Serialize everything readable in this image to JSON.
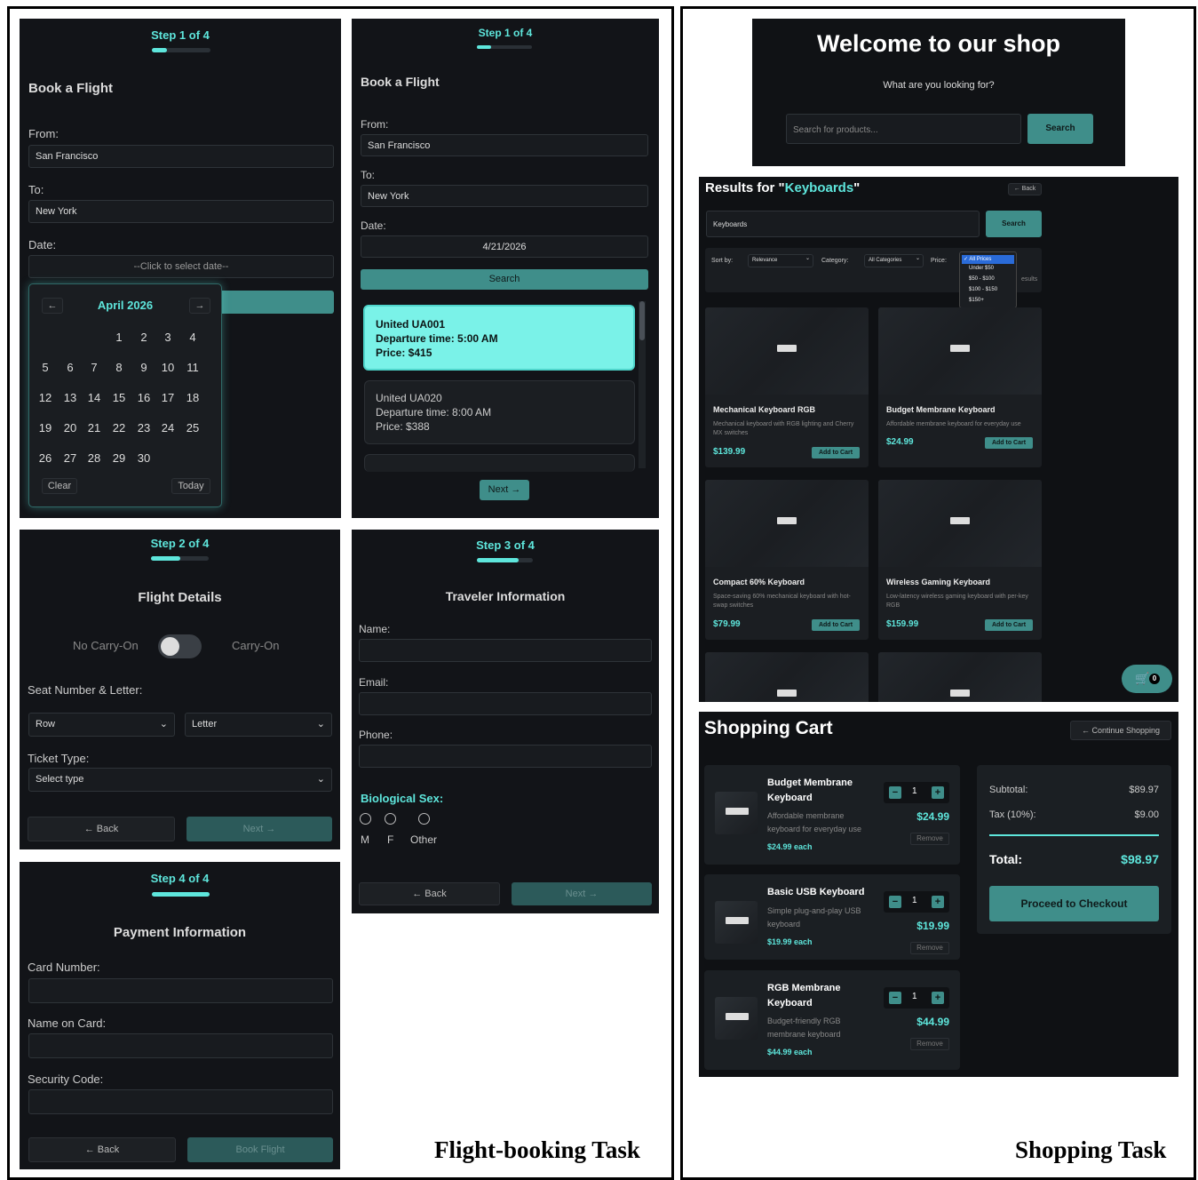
{
  "steps": {
    "s1": "Step 1 of 4",
    "s2": "Step 2 of 4",
    "s3": "Step 3 of 4",
    "s4": "Step 4 of 4"
  },
  "progress": {
    "s1": 0.25,
    "s2": 0.5,
    "s3": 0.75,
    "s4": 1.0
  },
  "book": {
    "title": "Book a Flight",
    "from_label": "From:",
    "from_value": "San Francisco",
    "to_label": "To:",
    "to_value": "New York",
    "date_label": "Date:",
    "date_placeholder": "--Click to select date--",
    "date_value": "4/21/2026",
    "search": "Search",
    "next": "Next →"
  },
  "calendar": {
    "month": "April 2026",
    "prev": "←",
    "next": "→",
    "clear": "Clear",
    "today": "Today",
    "weeks": [
      [
        "",
        "",
        "",
        "1",
        "2",
        "3",
        "4"
      ],
      [
        "5",
        "6",
        "7",
        "8",
        "9",
        "10",
        "11"
      ],
      [
        "12",
        "13",
        "14",
        "15",
        "16",
        "17",
        "18"
      ],
      [
        "19",
        "20",
        "21",
        "22",
        "23",
        "24",
        "25"
      ],
      [
        "26",
        "27",
        "28",
        "29",
        "30",
        "",
        ""
      ]
    ]
  },
  "flights": [
    {
      "name": "United UA001",
      "time": "Departure time: 5:00 AM",
      "price": "Price: $415"
    },
    {
      "name": "United UA020",
      "time": "Departure time: 8:00 AM",
      "price": "Price: $388"
    }
  ],
  "details": {
    "title": "Flight Details",
    "no_carry": "No Carry-On",
    "carry": "Carry-On",
    "seat_label": "Seat Number & Letter:",
    "row": "Row",
    "letter": "Letter",
    "ticket_label": "Ticket Type:",
    "ticket_value": "Select type",
    "back": "← Back",
    "next": "Next →"
  },
  "traveler": {
    "title": "Traveler Information",
    "name": "Name:",
    "email": "Email:",
    "phone": "Phone:",
    "sex": "Biological Sex:",
    "m": "M",
    "f": "F",
    "other": "Other",
    "back": "← Back",
    "next": "Next →"
  },
  "payment": {
    "title": "Payment Information",
    "card": "Card Number:",
    "name": "Name on Card:",
    "code": "Security Code:",
    "back": "← Back",
    "book": "Book Flight"
  },
  "tags": {
    "flight": "Flight-booking Task",
    "shop": "Shopping Task"
  },
  "welcome": {
    "title": "Welcome to our shop",
    "subtitle": "What are you looking for?",
    "placeholder": "Search for products...",
    "search": "Search"
  },
  "results": {
    "prefix": "Results for \"",
    "query": "Keyboards",
    "suffix": "\"",
    "back": "← Back",
    "search_value": "Keyboards",
    "search": "Search",
    "sort_label": "Sort by:",
    "sort_value": "Relevance",
    "cat_label": "Category:",
    "cat_value": "All Categories",
    "price_label": "Price:",
    "price_options": [
      "✓ All Prices",
      "Under $50",
      "$50 - $100",
      "$100 - $150",
      "$150+"
    ],
    "partial": "esults",
    "cart_count": "0",
    "products": [
      {
        "title": "Mechanical Keyboard RGB",
        "desc": "Mechanical keyboard with RGB lighting and Cherry MX switches",
        "price": "$139.99",
        "add": "Add to Cart"
      },
      {
        "title": "Budget Membrane Keyboard",
        "desc": "Affordable membrane keyboard for everyday use",
        "price": "$24.99",
        "add": "Add to Cart"
      },
      {
        "title": "Compact 60% Keyboard",
        "desc": "Space-saving 60% mechanical keyboard with hot-swap switches",
        "price": "$79.99",
        "add": "Add to Cart"
      },
      {
        "title": "Wireless Gaming Keyboard",
        "desc": "Low-latency wireless gaming keyboard with per-key RGB",
        "price": "$159.99",
        "add": "Add to Cart"
      }
    ]
  },
  "cart": {
    "title": "Shopping Cart",
    "continue": "← Continue Shopping",
    "items": [
      {
        "title1": "Budget Membrane",
        "title2": "Keyboard",
        "desc1": "Affordable membrane",
        "desc2": "keyboard for everyday use",
        "each": "$24.99 each",
        "qty": "1",
        "total": "$24.99",
        "remove": "Remove"
      },
      {
        "title1": "Basic USB Keyboard",
        "title2": "",
        "desc1": "Simple plug-and-play USB",
        "desc2": "keyboard",
        "each": "$19.99 each",
        "qty": "1",
        "total": "$19.99",
        "remove": "Remove"
      },
      {
        "title1": "RGB Membrane",
        "title2": "Keyboard",
        "desc1": "Budget-friendly RGB",
        "desc2": "membrane keyboard",
        "each": "$44.99 each",
        "qty": "1",
        "total": "$44.99",
        "remove": "Remove"
      }
    ],
    "subtotal_label": "Subtotal:",
    "subtotal": "$89.97",
    "tax_label": "Tax (10%):",
    "tax": "$9.00",
    "total_label": "Total:",
    "total": "$98.97",
    "checkout": "Proceed to Checkout",
    "minus": "−",
    "plus": "+"
  }
}
